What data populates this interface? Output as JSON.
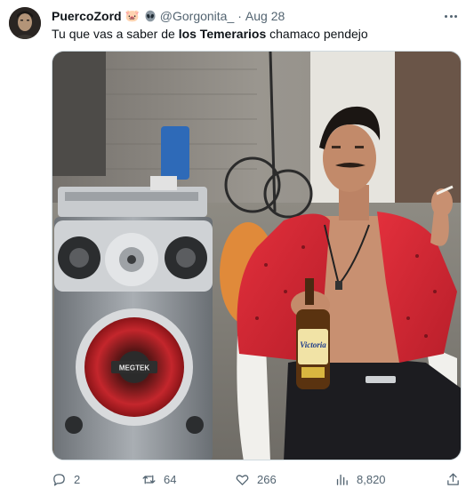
{
  "tweet": {
    "author": {
      "display_name": "PuercoZord",
      "emoji": "🐷",
      "handle": "@Gorgonita_",
      "separator": "·",
      "date": "Aug 28"
    },
    "text": {
      "part1": "Tu que vas a saber de ",
      "bold": "los Temerarios",
      "part2": " chamaco pendejo"
    },
    "media": {
      "speaker_brand": "MEGTEK",
      "bottle_label": "Victoria"
    },
    "stats": {
      "replies": "2",
      "retweets": "64",
      "likes": "266",
      "views": "8,820"
    }
  },
  "icons": {
    "more": "more-icon",
    "reply": "reply-icon",
    "retweet": "retweet-icon",
    "like": "heart-icon",
    "views": "views-icon",
    "share": "share-icon"
  }
}
